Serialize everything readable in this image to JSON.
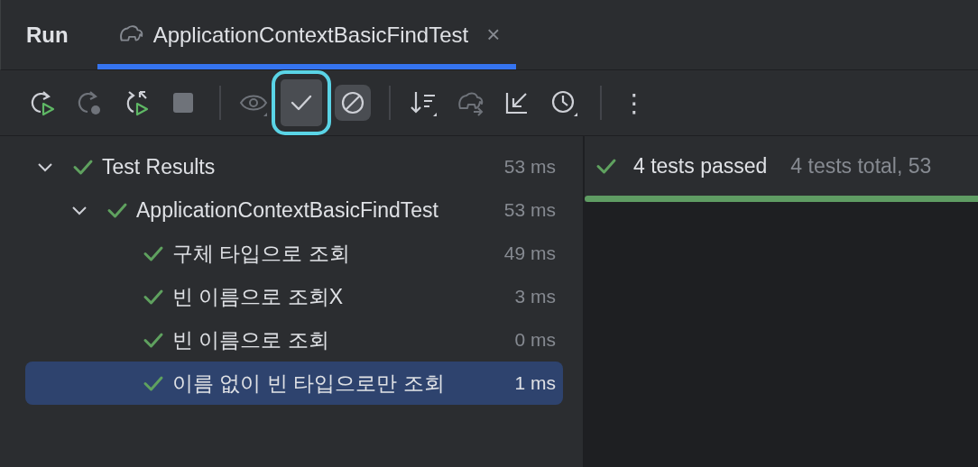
{
  "header": {
    "title": "Run",
    "tab": {
      "label": "ApplicationContextBasicFindTest",
      "selected": true,
      "close": "×"
    }
  },
  "toolbar": [
    {
      "kind": "rerun",
      "disabled": false,
      "selected": false,
      "focused": false
    },
    {
      "kind": "rerun-failed",
      "disabled": true,
      "selected": false,
      "focused": false
    },
    {
      "kind": "auto-rerun",
      "disabled": false,
      "selected": false,
      "focused": false
    },
    {
      "kind": "stop",
      "disabled": true,
      "selected": false,
      "focused": false
    },
    {
      "kind": "separator"
    },
    {
      "kind": "eye",
      "disabled": true,
      "selected": false,
      "focused": false
    },
    {
      "kind": "show-passed",
      "disabled": false,
      "selected": true,
      "focused": true
    },
    {
      "kind": "show-ignored",
      "disabled": false,
      "selected": true,
      "focused": false
    },
    {
      "kind": "separator"
    },
    {
      "kind": "sort",
      "disabled": false,
      "selected": false,
      "focused": false
    },
    {
      "kind": "gradle",
      "disabled": true,
      "selected": false,
      "focused": false
    },
    {
      "kind": "import",
      "disabled": false,
      "selected": false,
      "focused": false
    },
    {
      "kind": "history",
      "disabled": false,
      "selected": false,
      "focused": false
    },
    {
      "kind": "separator"
    },
    {
      "kind": "more",
      "label": "⋮",
      "disabled": false,
      "selected": false,
      "focused": false
    }
  ],
  "tree": [
    {
      "label": "Test Results",
      "duration": "53 ms",
      "passed": true,
      "expanded": true,
      "selected": false,
      "children": [
        {
          "label": "ApplicationContextBasicFindTest",
          "duration": "53 ms",
          "passed": true,
          "expanded": true,
          "selected": false,
          "children": [
            {
              "label": "구체 타입으로 조회",
              "duration": "49 ms",
              "passed": true,
              "selected": false
            },
            {
              "label": "빈 이름으로 조회X",
              "duration": "3 ms",
              "passed": true,
              "selected": false
            },
            {
              "label": "빈 이름으로 조회",
              "duration": "0 ms",
              "passed": true,
              "selected": false
            },
            {
              "label": "이름 없이 빈 타입으로만 조회",
              "duration": "1 ms",
              "passed": true,
              "selected": true
            }
          ]
        }
      ]
    }
  ],
  "summary": {
    "passed": true,
    "status": "4 tests passed",
    "detail": "4 tests total, 53",
    "level": 1
  }
}
